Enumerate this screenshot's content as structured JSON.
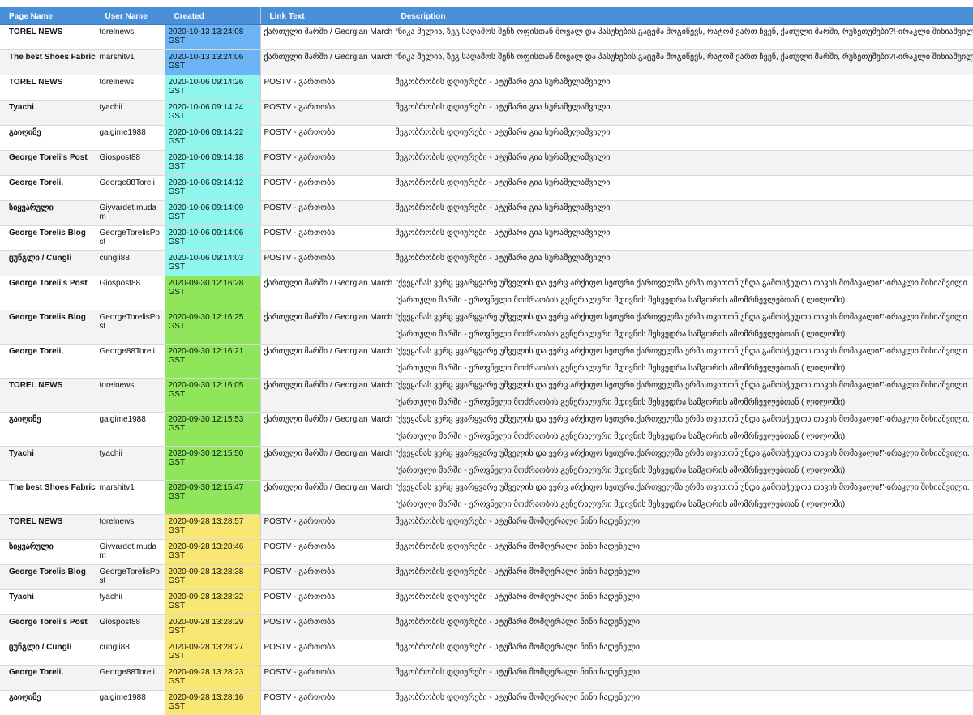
{
  "colors": {
    "header_bg": "#4a90d9",
    "created_blue": "#6cb4f5",
    "created_cyan": "#8ff6ee",
    "created_green": "#8fe65b",
    "created_yellow": "#f8e873"
  },
  "columns": [
    "Page Name",
    "User Name",
    "Created",
    "Link Text",
    "Description"
  ],
  "rows": [
    {
      "page": "TOREL NEWS",
      "user": "torelnews",
      "created": "2020-10-13 13:24:08 GST",
      "color": "#6cb4f5",
      "link": "ქართული მარში / Georgian March",
      "desc": "“ნიკა მელია, ზეგ საღამოს შენს ოფისთან მოვალ და პასუხების გაცემა მოგიწევს, რატომ ვართ ჩვენ, ქათული მარში, რუსეთუმები?!-ირაკლი შიხიაშვილი",
      "desc2": ""
    },
    {
      "page": "The best Shoes Fabric",
      "user": "marshitv1",
      "created": "2020-10-13 13:24:06 GST",
      "color": "#6cb4f5",
      "link": "ქართული მარში / Georgian March",
      "desc": "“ნიკა მელია, ზეგ საღამოს შენს ოფისთან მოვალ და პასუხების გაცემა მოგიწევს, რატომ ვართ ჩვენ, ქათული მარში, რუსეთუმები?!-ირაკლი შიხიაშვილი",
      "desc2": ""
    },
    {
      "page": "TOREL NEWS",
      "user": "torelnews",
      "created": "2020-10-06 09:14:26 GST",
      "color": "#8ff6ee",
      "link": "POSTV - გართობა",
      "desc": "მეგობრობის დღიურები - სტუმარი გია სურამელაშვილი",
      "desc2": ""
    },
    {
      "page": "Tyachi",
      "user": "tyachii",
      "created": "2020-10-06 09:14:24 GST",
      "color": "#8ff6ee",
      "link": "POSTV - გართობა",
      "desc": "მეგობრობის დღიურები - სტუმარი გია სურამელაშვილი",
      "desc2": ""
    },
    {
      "page": "გაიღიმე",
      "user": "gaigime1988",
      "created": "2020-10-06 09:14:22 GST",
      "color": "#8ff6ee",
      "link": "POSTV - გართობა",
      "desc": "მეგობრობის დღიურები - სტუმარი გია სურამელაშვილი",
      "desc2": ""
    },
    {
      "page": "George Toreli's Post",
      "user": "Giospost88",
      "created": "2020-10-06 09:14:18 GST",
      "color": "#8ff6ee",
      "link": "POSTV - გართობა",
      "desc": "მეგობრობის დღიურები - სტუმარი გია სურამელაშვილი",
      "desc2": ""
    },
    {
      "page": "George Toreli,",
      "user": "George88Toreli",
      "created": "2020-10-06 09:14:12 GST",
      "color": "#8ff6ee",
      "link": "POSTV - გართობა",
      "desc": "მეგობრობის დღიურები - სტუმარი გია სურამელაშვილი",
      "desc2": ""
    },
    {
      "page": "სიყვარული",
      "user": "Giyvardet.mudam",
      "created": "2020-10-06 09:14:09 GST",
      "color": "#8ff6ee",
      "link": "POSTV - გართობა",
      "desc": "მეგობრობის დღიურები - სტუმარი გია სურამელაშვილი",
      "desc2": ""
    },
    {
      "page": "George Torelis Blog",
      "user": "GeorgeTorelisPost",
      "created": "2020-10-06 09:14:06 GST",
      "color": "#8ff6ee",
      "link": "POSTV - გართობა",
      "desc": "მეგობრობის დღიურები - სტუმარი გია სურამელაშვილი",
      "desc2": ""
    },
    {
      "page": "ცუნგლი / Cungli",
      "user": "cungli88",
      "created": "2020-10-06 09:14:03 GST",
      "color": "#8ff6ee",
      "link": "POSTV - გართობა",
      "desc": "მეგობრობის დღიურები - სტუმარი გია სურამელაშვილი",
      "desc2": ""
    },
    {
      "page": "George Toreli's Post",
      "user": "Giospost88",
      "created": "2020-09-30 12:16:28 GST",
      "color": "#8fe65b",
      "link": "ქართული მარში / Georgian March",
      "desc": "\"ქვეყანას ვერც ყვარყვარე უშველის და ვერც არქიფო სეთური.ქართველმა ერმა თვითონ უნდა გამოსჭედოს თავის მომავალი!\"-ირაკლი შიხიაშვილი.",
      "desc2": "\"ქართული მარში - ეროვნული მოძრაობის გენერალური მდივნის   შეხვედრა სამგორის ამომრჩევლებთან ( ლილოში)"
    },
    {
      "page": "George Torelis Blog",
      "user": "GeorgeTorelisPost",
      "created": "2020-09-30 12:16:25 GST",
      "color": "#8fe65b",
      "link": "ქართული მარში / Georgian March",
      "desc": "\"ქვეყანას ვერც ყვარყვარე უშველის და ვერც არქიფო სეთური.ქართველმა ერმა თვითონ უნდა გამოსჭედოს თავის მომავალი!\"-ირაკლი შიხიაშვილი.",
      "desc2": "\"ქართული მარში - ეროვნული მოძრაობის გენერალური მდივნის   შეხვედრა სამგორის ამომრჩევლებთან ( ლილოში)"
    },
    {
      "page": "George Toreli,",
      "user": "George88Toreli",
      "created": "2020-09-30 12:16:21 GST",
      "color": "#8fe65b",
      "link": "ქართული მარში / Georgian March",
      "desc": "\"ქვეყანას ვერც ყვარყვარე უშველის და ვერც არქიფო სეთური.ქართველმა ერმა თვითონ უნდა გამოსჭედოს თავის მომავალი!\"-ირაკლი შიხიაშვილი.",
      "desc2": "\"ქართული მარში - ეროვნული მოძრაობის გენერალური მდივნის   შეხვედრა სამგორის ამომრჩევლებთან ( ლილოში)"
    },
    {
      "page": "TOREL NEWS",
      "user": "torelnews",
      "created": "2020-09-30 12:16:05 GST",
      "color": "#8fe65b",
      "link": "ქართული მარში / Georgian March",
      "desc": "\"ქვეყანას ვერც ყვარყვარე უშველის და ვერც არქიფო სეთური.ქართველმა ერმა თვითონ უნდა გამოსჭედოს თავის მომავალი!\"-ირაკლი შიხიაშვილი.",
      "desc2": "\"ქართული მარში - ეროვნული მოძრაობის გენერალური მდივნის   შეხვედრა სამგორის ამომრჩევლებთან ( ლილოში)"
    },
    {
      "page": "გაიღიმე",
      "user": "gaigime1988",
      "created": "2020-09-30 12:15:53 GST",
      "color": "#8fe65b",
      "link": "ქართული მარში / Georgian March",
      "desc": "\"ქვეყანას ვერც ყვარყვარე უშველის და ვერც არქიფო სეთური.ქართველმა ერმა თვითონ უნდა გამოსჭედოს თავის მომავალი!\"-ირაკლი შიხიაშვილი.",
      "desc2": "\"ქართული მარში - ეროვნული მოძრაობის გენერალური მდივნის   შეხვედრა სამგორის ამომრჩევლებთან ( ლილოში)"
    },
    {
      "page": "Tyachi",
      "user": "tyachii",
      "created": "2020-09-30 12:15:50 GST",
      "color": "#8fe65b",
      "link": "ქართული მარში / Georgian March",
      "desc": "\"ქვეყანას ვერც ყვარყვარე უშველის და ვერც არქიფო სეთური.ქართველმა ერმა თვითონ უნდა გამოსჭედოს თავის მომავალი!\"-ირაკლი შიხიაშვილი.",
      "desc2": "\"ქართული მარში - ეროვნული მოძრაობის გენერალური მდივნის   შეხვედრა სამგორის ამომრჩევლებთან ( ლილოში)"
    },
    {
      "page": "The best Shoes Fabric",
      "user": "marshitv1",
      "created": "2020-09-30 12:15:47 GST",
      "color": "#8fe65b",
      "link": "ქართული მარში / Georgian March",
      "desc": "\"ქვეყანას ვერც ყვარყვარე უშველის და ვერც არქიფო სეთური.ქართველმა ერმა თვითონ უნდა გამოსჭედოს თავის მომავალი!\"-ირაკლი შიხიაშვილი.",
      "desc2": "\"ქართული მარში - ეროვნული მოძრაობის გენერალური მდივნის   შეხვედრა სამგორის ამომრჩევლებთან ( ლილოში)"
    },
    {
      "page": "TOREL NEWS",
      "user": "torelnews",
      "created": "2020-09-28 13:28:57 GST",
      "color": "#f8e873",
      "link": "POSTV - გართობა",
      "desc": "მეგობრობის დღიურები - სტუმარი მომღერალი ნინი ჩადუნელი",
      "desc2": ""
    },
    {
      "page": "სიყვარული",
      "user": "Giyvardet.mudam",
      "created": "2020-09-28 13:28:46 GST",
      "color": "#f8e873",
      "link": "POSTV - გართობა",
      "desc": "მეგობრობის დღიურები - სტუმარი მომღერალი ნინი ჩადუნელი",
      "desc2": ""
    },
    {
      "page": "George Torelis Blog",
      "user": "GeorgeTorelisPost",
      "created": "2020-09-28 13:28:38 GST",
      "color": "#f8e873",
      "link": "POSTV - გართობა",
      "desc": "მეგობრობის დღიურები - სტუმარი მომღერალი ნინი ჩადუნელი",
      "desc2": ""
    },
    {
      "page": "Tyachi",
      "user": "tyachii",
      "created": "2020-09-28 13:28:32 GST",
      "color": "#f8e873",
      "link": "POSTV - გართობა",
      "desc": "მეგობრობის დღიურები - სტუმარი მომღერალი ნინი ჩადუნელი",
      "desc2": ""
    },
    {
      "page": "George Toreli's Post",
      "user": "Giospost88",
      "created": "2020-09-28 13:28:29 GST",
      "color": "#f8e873",
      "link": "POSTV - გართობა",
      "desc": "მეგობრობის დღიურები - სტუმარი მომღერალი ნინი ჩადუნელი",
      "desc2": ""
    },
    {
      "page": "ცუნგლი / Cungli",
      "user": "cungli88",
      "created": "2020-09-28 13:28:27 GST",
      "color": "#f8e873",
      "link": "POSTV - გართობა",
      "desc": "მეგობრობის დღიურები - სტუმარი მომღერალი ნინი ჩადუნელი",
      "desc2": ""
    },
    {
      "page": "George Toreli,",
      "user": "George88Toreli",
      "created": "2020-09-28 13:28:23 GST",
      "color": "#f8e873",
      "link": "POSTV - გართობა",
      "desc": "მეგობრობის დღიურები - სტუმარი მომღერალი ნინი ჩადუნელი",
      "desc2": ""
    },
    {
      "page": "გაიღიმე",
      "user": "gaigime1988",
      "created": "2020-09-28 13:28:16 GST",
      "color": "#f8e873",
      "link": "POSTV - გართობა",
      "desc": "მეგობრობის დღიურები - სტუმარი მომღერალი ნინი ჩადუნელი",
      "desc2": ""
    }
  ]
}
